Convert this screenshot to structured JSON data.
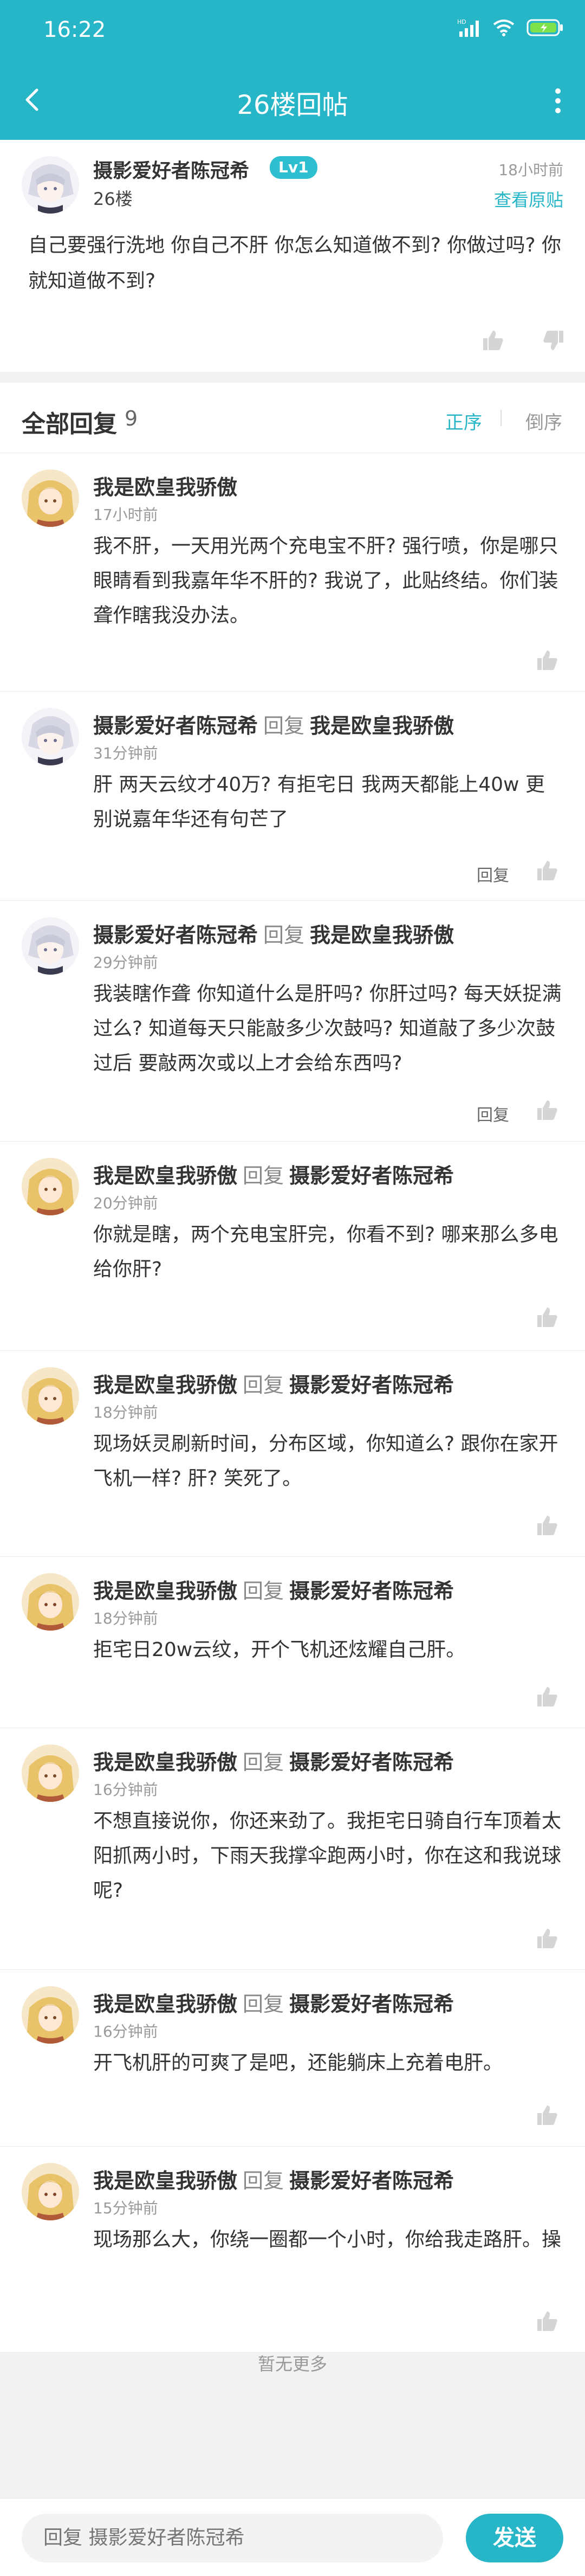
{
  "status_bar": {
    "time": "16:22",
    "network": "HD"
  },
  "header": {
    "title": "26楼回帖"
  },
  "post": {
    "author": "摄影爱好者陈冠希",
    "level": "Lv1",
    "floor": "26楼",
    "time": "18小时前",
    "view_original": "查看原贴",
    "content": "自己要强行洗地 你自己不肝 你怎么知道做不到? 你做过吗? 你就知道做不到?"
  },
  "replies_header": {
    "label": "全部回复",
    "count": "9",
    "sort_asc": "正序",
    "sort_desc": "倒序"
  },
  "reply_word": "回复",
  "replies": [
    {
      "author": "我是欧皇我骄傲",
      "target": "",
      "time": "17小时前",
      "text": "我不肝，一天用光两个充电宝不肝? 强行喷，你是哪只眼睛看到我嘉年华不肝的? 我说了，此贴终结。你们装聋作瞎我没办法。",
      "reply_label": ""
    },
    {
      "author": "摄影爱好者陈冠希",
      "target": "我是欧皇我骄傲",
      "time": "31分钟前",
      "text": "肝 两天云纹才40万? 有拒宅日 我两天都能上40w 更别说嘉年华还有句芒了",
      "reply_label": "回复"
    },
    {
      "author": "摄影爱好者陈冠希",
      "target": "我是欧皇我骄傲",
      "time": "29分钟前",
      "text": "我装瞎作聋 你知道什么是肝吗? 你肝过吗? 每天妖捉满过么? 知道每天只能敲多少次鼓吗? 知道敲了多少次鼓过后 要敲两次或以上才会给东西吗?",
      "reply_label": "回复"
    },
    {
      "author": "我是欧皇我骄傲",
      "target": "摄影爱好者陈冠希",
      "time": "20分钟前",
      "text": "你就是瞎，两个充电宝肝完，你看不到? 哪来那么多电给你肝?",
      "reply_label": ""
    },
    {
      "author": "我是欧皇我骄傲",
      "target": "摄影爱好者陈冠希",
      "time": "18分钟前",
      "text": "现场妖灵刷新时间，分布区域，你知道么? 跟你在家开飞机一样? 肝? 笑死了。",
      "reply_label": ""
    },
    {
      "author": "我是欧皇我骄傲",
      "target": "摄影爱好者陈冠希",
      "time": "18分钟前",
      "text": "拒宅日20w云纹，开个飞机还炫耀自己肝。",
      "reply_label": ""
    },
    {
      "author": "我是欧皇我骄傲",
      "target": "摄影爱好者陈冠希",
      "time": "16分钟前",
      "text": "不想直接说你，你还来劲了。我拒宅日骑自行车顶着太阳抓两小时，下雨天我撑伞跑两小时，你在这和我说球呢?",
      "reply_label": ""
    },
    {
      "author": "我是欧皇我骄傲",
      "target": "摄影爱好者陈冠希",
      "time": "16分钟前",
      "text": "开飞机肝的可爽了是吧，还能躺床上充着电肝。",
      "reply_label": ""
    },
    {
      "author": "我是欧皇我骄傲",
      "target": "摄影爱好者陈冠希",
      "time": "15分钟前",
      "text": "现场那么大，你绕一圈都一个小时，你给我走路肝。操",
      "reply_label": ""
    }
  ],
  "footer_note": "暂无更多",
  "bottom_bar": {
    "input_placeholder": "回复 摄影爱好者陈冠希",
    "send_label": "发送"
  },
  "colors": {
    "accent": "#27b6c8",
    "background": "#f2f2f2"
  },
  "icons": [
    "back-arrow-icon",
    "more-vertical-icon",
    "thumbs-up-icon",
    "thumbs-down-icon",
    "signal-icon",
    "wifi-icon",
    "battery-icon"
  ]
}
